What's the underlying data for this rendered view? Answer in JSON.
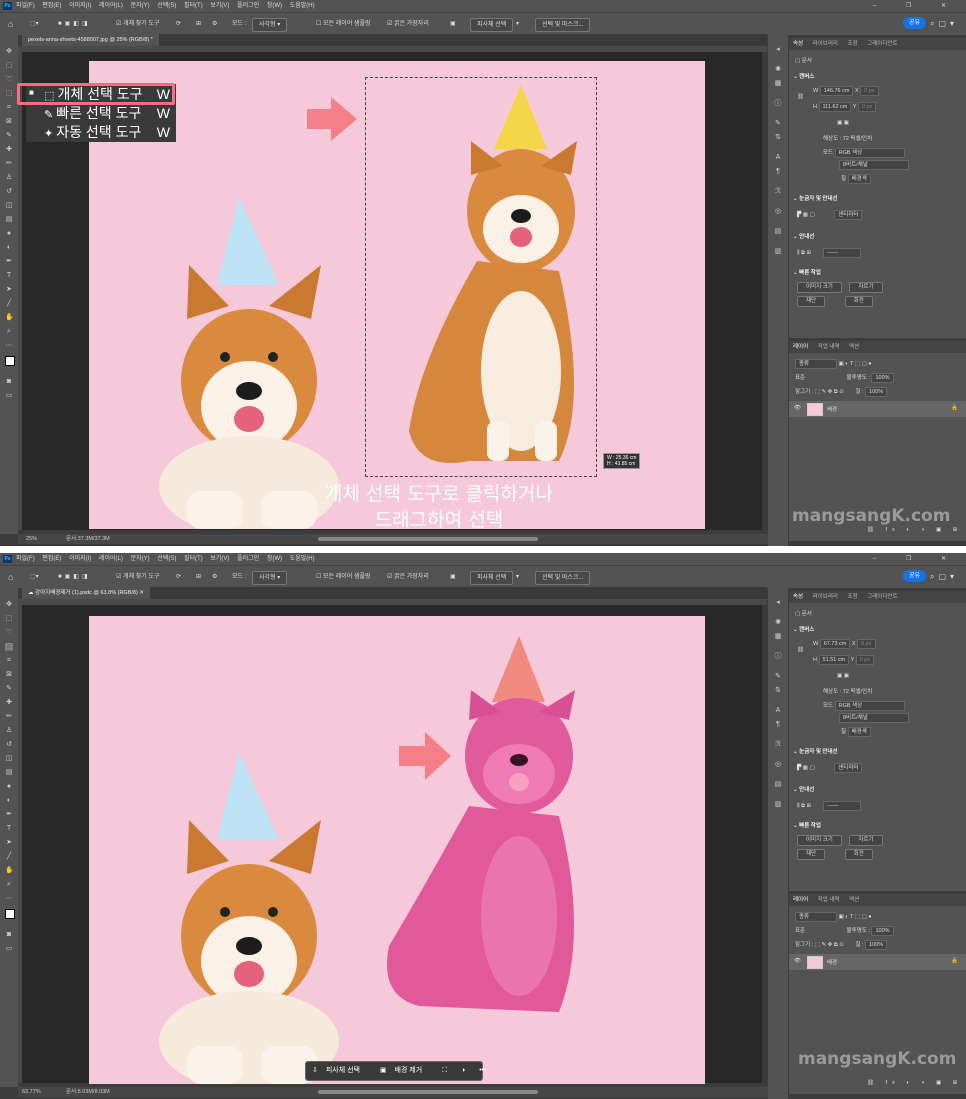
{
  "menu": {
    "app_logo": "Ps",
    "items": [
      "파일(F)",
      "편집(E)",
      "이미지(I)",
      "레이어(L)",
      "문자(Y)",
      "선택(S)",
      "필터(T)",
      "보기(V)",
      "플러그인",
      "창(W)",
      "도움말(H)"
    ],
    "window_buttons": "– ❐ ✕"
  },
  "options": {
    "home_icon": "home-icon",
    "mode_label": "모드 :",
    "mode_value": "사각형",
    "sample_all_label": "모든 레이어 샘플링",
    "hard_edge_label": "굵은 가장자리",
    "object_finder_label": "개체 찾기 도구",
    "subject_button": "피사체 선택",
    "select_mask_button": "선택 및 마스크...",
    "share_button": "공유"
  },
  "top": {
    "tab_title": "pexels-anna-shvets-4588007.jpg @ 25% (RGB/8) *",
    "zoom": "25%",
    "doc_info": "문서:37.3M/37.3M",
    "flyout": [
      {
        "label": "개체 선택 도구",
        "shortcut": "W"
      },
      {
        "label": "빠른 선택 도구",
        "shortcut": "W"
      },
      {
        "label": "자동 선택 도구",
        "shortcut": "W"
      }
    ],
    "caption_line1": "개체 선택 도구로 클릭하거나",
    "caption_line2": "드래그하여 선택",
    "dim_w": "W : 25.36 cm",
    "dim_h": "H : 43.85 cm",
    "props": {
      "tabs": [
        "속성",
        "라이브러리",
        "조정",
        "그레이디언트"
      ],
      "doc_label": "문서",
      "canvas_header": "캔버스",
      "w_label": "W",
      "w_value": "146.76 cm",
      "h_label": "H",
      "h_value": "111.62 cm",
      "x_label": "X",
      "x_value": "0 px",
      "y_label": "Y",
      "y_value": "0 px",
      "resolution": "해상도 : 72 픽셀/인치",
      "mode_label": "모드",
      "mode_value": "RGB 색상",
      "bit_value": "8비트/채널",
      "fill_label": "칠",
      "fill_value": "배경색",
      "ruler_header": "눈금자 및 안내선",
      "ruler_unit": "센티미터",
      "guide_header": "안내선",
      "quick_header": "빠른 작업",
      "btn_image_size": "이미지 크기",
      "btn_crop": "자르기",
      "btn_trim": "재단",
      "btn_rotate": "회전"
    },
    "layers": {
      "tabs": [
        "레이어",
        "작업 내역",
        "액션"
      ],
      "search_placeholder": "종류",
      "blend": "표준",
      "opacity_label": "불투명도 :",
      "opacity": "100%",
      "lock_label": "잠그기 :",
      "fill_label": "칠 :",
      "fill": "100%",
      "layer_name": "배경"
    }
  },
  "bottom": {
    "tab_title": "강아지배경제거 (1).psdc @ 63.8% (RGB/8)",
    "zoom": "63.77%",
    "doc_info": "문서:8.03M/8.03M",
    "ctx_subject": "피사체 선택",
    "ctx_remove_bg": "배경 제거",
    "ctx_more": "•••",
    "props": {
      "tabs": [
        "속성",
        "라이브러리",
        "조정",
        "그레이디언트"
      ],
      "doc_label": "문서",
      "canvas_header": "캔버스",
      "w_label": "W",
      "w_value": "67.73 cm",
      "h_label": "H",
      "h_value": "51.51 cm",
      "x_label": "X",
      "x_value": "0 px",
      "y_label": "Y",
      "y_value": "0 px",
      "resolution": "해상도 : 72 픽셀/인치",
      "mode_label": "모드",
      "mode_value": "RGB 색상",
      "bit_value": "8비트/채널",
      "fill_label": "칠",
      "fill_value": "배경색",
      "ruler_header": "눈금자 및 안내선",
      "ruler_unit": "센티미터",
      "guide_header": "안내선",
      "quick_header": "빠른 작업",
      "btn_image_size": "이미지 크기",
      "btn_crop": "자르기",
      "btn_trim": "재단",
      "btn_rotate": "회전"
    },
    "layers": {
      "tabs": [
        "레이어",
        "작업 내역",
        "액션"
      ],
      "search_placeholder": "종류",
      "blend": "표준",
      "opacity_label": "불투명도 :",
      "opacity": "100%",
      "lock_label": "잠그기 :",
      "fill_label": "칠 :",
      "fill": "100%",
      "layer_name": "배경"
    }
  },
  "watermark": "mangsangK.com",
  "colors": {
    "highlight": "#ff6b7e",
    "arrow": "#f47f86",
    "accent": "#1473e6",
    "canvas_bg": "#f5c9d9",
    "selection_overlay": "#f0608f"
  }
}
